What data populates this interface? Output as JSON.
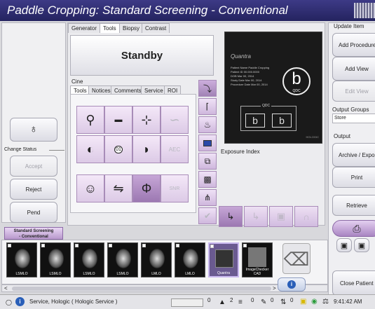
{
  "title": "Paddle Cropping:  Standard Screening - Conventional",
  "tabs": [
    {
      "label": "Generator"
    },
    {
      "label": "Tools"
    },
    {
      "label": "Biopsy"
    },
    {
      "label": "Contrast"
    }
  ],
  "standby_label": "Standby",
  "cine_label": "Cine",
  "subtabs": [
    {
      "label": "Tools"
    },
    {
      "label": "Notices"
    },
    {
      "label": "Comments"
    },
    {
      "label": "Service"
    },
    {
      "label": "ROI"
    }
  ],
  "preview": {
    "brand": "Quantra",
    "rows": [
      {
        "k": "Patient Name",
        "v": "Paddle Cropping"
      },
      {
        "k": "Patient ID",
        "v": "00.000.0000"
      },
      {
        "k": "DOB",
        "v": "Mar 00, 2014"
      },
      {
        "k": "Study Date",
        "v": "Mar 00, 2014"
      },
      {
        "k": "Procedure Date",
        "v": "Mar 00, 2014"
      }
    ],
    "big_letter": "b",
    "big_caption": "QDC",
    "box_title": "QDC",
    "box_letters": [
      "b",
      "b"
    ],
    "box_footer": "HOLOGIC"
  },
  "exposure_index_label": "Exposure Index",
  "left": {
    "change_status": "Change Status",
    "accept": "Accept",
    "reject": "Reject",
    "pend": "Pend"
  },
  "right": {
    "update_item": "Update Item",
    "add_procedure": "Add Procedure",
    "add_view": "Add View",
    "edit_view": "Edit View",
    "output_groups": "Output Groups",
    "output_groups_value": "Store",
    "output": "Output",
    "archive_export": "Archive / Export",
    "print": "Print",
    "retrieve": "Retrieve",
    "close_patient": "Close Patient"
  },
  "procedure_tab": [
    "Standard Screening",
    "- Conventional"
  ],
  "thumbnails": [
    {
      "label": "LSMLO"
    },
    {
      "label": "LSMLO"
    },
    {
      "label": "LSMLO"
    },
    {
      "label": "LSMLO"
    },
    {
      "label": "LMLO"
    },
    {
      "label": "LMLO"
    },
    {
      "label": "Quantra"
    },
    {
      "label": "ImageChecker CAD"
    }
  ],
  "tool_text": {
    "magnify_marker": "01",
    "aec": "AEC",
    "snr": "SNR"
  },
  "statusbar": {
    "service_text": "Service, Hologic ( Hologic Service )",
    "counters": [
      "0",
      "2",
      "0",
      "0",
      "0"
    ],
    "time": "9:41:42 AM"
  },
  "colors": {
    "title_bg": "#2c2a6e",
    "accent_purple": "#9c78b2",
    "tool_bg": "#e8d8f0"
  }
}
